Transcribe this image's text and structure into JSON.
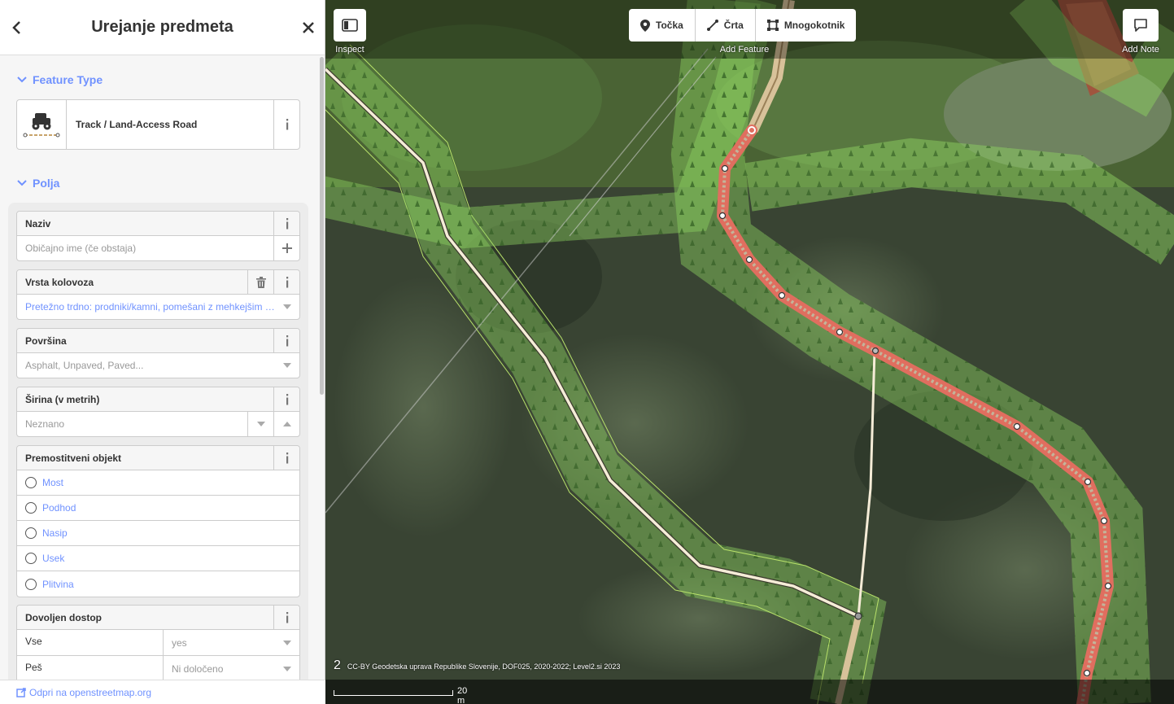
{
  "sidebar": {
    "title": "Urejanje predmeta",
    "feature_type_section": "Feature Type",
    "preset_name": "Track / Land-Access Road",
    "fields_section": "Polja",
    "fields": {
      "name": {
        "label": "Naziv",
        "placeholder": "Običajno ime (če obstaja)"
      },
      "tracktype": {
        "label": "Vrsta kolovoza",
        "value": "Pretežno trdno: prodniki/kamni, pomešani z mehkejšim m..."
      },
      "surface": {
        "label": "Površina",
        "placeholder": "Asphalt, Unpaved, Paved..."
      },
      "width": {
        "label": "Širina (v metrih)",
        "placeholder": "Neznano"
      },
      "structure": {
        "label": "Premostitveni objekt",
        "options": [
          "Most",
          "Podhod",
          "Nasip",
          "Usek",
          "Plitvina"
        ]
      },
      "access": {
        "label": "Dovoljen dostop",
        "rows": [
          {
            "key": "Vse",
            "value": "yes"
          },
          {
            "key": "Peš",
            "value": "Ni določeno"
          }
        ]
      }
    },
    "footer_link": "Odpri na openstreetmap.org"
  },
  "map": {
    "inspect_label": "Inspect",
    "add_feature_label": "Add Feature",
    "add_note_label": "Add Note",
    "add_buttons": [
      "Točka",
      "Črta",
      "Mnogokotnik"
    ],
    "imagery_offset": "2",
    "attribution": "CC-BY Geodetska uprava Republike Slovenije, DOF025, 2020-2022; Level2.si 2023",
    "scale_label": "20 m"
  },
  "colors": {
    "accent": "#7092ff",
    "selected_way": "#e06e5f",
    "forest_fill": "#8cd05f",
    "track_line": "#f5ecd7"
  }
}
